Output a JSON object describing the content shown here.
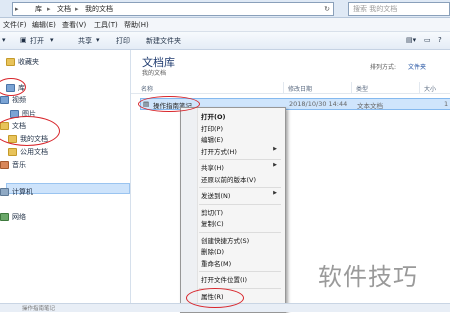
{
  "address_bar": {
    "path": [
      "库",
      "文档",
      "我的文档"
    ],
    "search_placeholder": "搜索 我的文档"
  },
  "menu": [
    "文件(F)",
    "编辑(E)",
    "查看(V)",
    "工具(T)",
    "帮助(H)"
  ],
  "toolbar": {
    "organize": "组织",
    "open": "打开",
    "share": "共享",
    "print": "打印",
    "new_folder": "新建文件夹"
  },
  "nav": {
    "favorites": "收藏夹",
    "libraries": "库",
    "videos": "视频",
    "pictures": "图片",
    "documents": "文档",
    "my_documents": "我的文档",
    "public_documents": "公用文档",
    "music": "音乐",
    "computer": "计算机",
    "network": "网络"
  },
  "content": {
    "library_title": "文档库",
    "library_subtitle": "我的文档",
    "arrange_label": "排列方式:",
    "arrange_value": "文件夹",
    "columns": [
      "名称",
      "修改日期",
      "类型",
      "大小"
    ],
    "row": {
      "name": "操作指南笔记",
      "date": "2018/10/30 14:44",
      "type": "文本文档",
      "size": "1"
    }
  },
  "context_menu": {
    "items": [
      {
        "label": "打开(O)",
        "bold": true
      },
      {
        "label": "打印(P)"
      },
      {
        "label": "编辑(E)"
      },
      {
        "label": "打开方式(H)",
        "submenu": true
      },
      {
        "sep": true
      },
      {
        "label": "共享(H)",
        "submenu": true
      },
      {
        "label": "还原以前的版本(V)"
      },
      {
        "sep": true
      },
      {
        "label": "发送到(N)",
        "submenu": true
      },
      {
        "sep": true
      },
      {
        "label": "剪切(T)"
      },
      {
        "label": "复制(C)"
      },
      {
        "sep": true
      },
      {
        "label": "创建快捷方式(S)"
      },
      {
        "label": "删除(D)"
      },
      {
        "label": "重命名(M)"
      },
      {
        "sep": true
      },
      {
        "label": "打开文件位置(I)"
      },
      {
        "sep": true
      },
      {
        "label": "属性(R)"
      }
    ]
  },
  "status": {
    "text": "操作指南笔记"
  },
  "watermark": "软件技巧",
  "accent": {
    "annotation_red": "#d8262c",
    "selection_blue": "#cfe5fc"
  }
}
